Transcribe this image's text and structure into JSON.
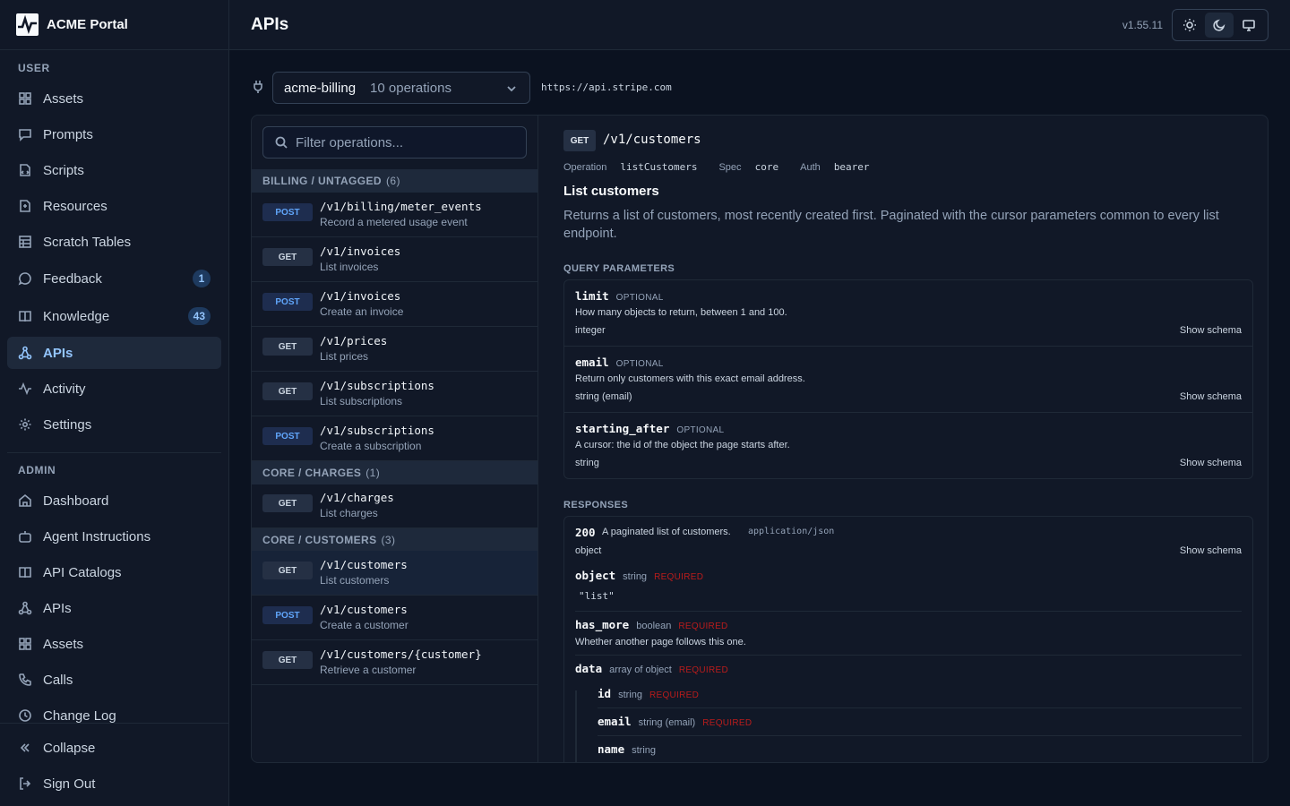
{
  "app": {
    "name": "ACME Portal",
    "version": "v1.55.11"
  },
  "sidebar": {
    "user_label": "USER",
    "admin_label": "ADMIN",
    "user_items": [
      {
        "label": "Assets",
        "icon": "grid-icon"
      },
      {
        "label": "Prompts",
        "icon": "message-icon"
      },
      {
        "label": "Scripts",
        "icon": "code-icon"
      },
      {
        "label": "Resources",
        "icon": "file-icon"
      },
      {
        "label": "Scratch Tables",
        "icon": "table-icon"
      },
      {
        "label": "Feedback",
        "icon": "chat-icon",
        "badge": "1"
      },
      {
        "label": "Knowledge",
        "icon": "book-icon",
        "badge": "43"
      },
      {
        "label": "APIs",
        "icon": "network-icon",
        "active": true
      },
      {
        "label": "Activity",
        "icon": "activity-icon"
      },
      {
        "label": "Settings",
        "icon": "gear-icon"
      }
    ],
    "admin_items": [
      {
        "label": "Dashboard",
        "icon": "home-icon"
      },
      {
        "label": "Agent Instructions",
        "icon": "bot-icon"
      },
      {
        "label": "API Catalogs",
        "icon": "book-icon"
      },
      {
        "label": "APIs",
        "icon": "network-icon"
      },
      {
        "label": "Assets",
        "icon": "grid-icon"
      },
      {
        "label": "Calls",
        "icon": "phone-icon"
      },
      {
        "label": "Change Log",
        "icon": "clock-icon"
      }
    ],
    "footer": {
      "collapse": "Collapse",
      "sign_out": "Sign Out"
    }
  },
  "header": {
    "title": "APIs"
  },
  "toolbar": {
    "api_name": "acme-billing",
    "api_ops": "10 operations",
    "base_url": "https://api.stripe.com"
  },
  "ops": {
    "filter_placeholder": "Filter operations...",
    "groups": [
      {
        "name": "BILLING / UNTAGGED",
        "count": "(6)",
        "items": [
          {
            "method": "POST",
            "path": "/v1/billing/meter_events",
            "summary": "Record a metered usage event"
          },
          {
            "method": "GET",
            "path": "/v1/invoices",
            "summary": "List invoices"
          },
          {
            "method": "POST",
            "path": "/v1/invoices",
            "summary": "Create an invoice"
          },
          {
            "method": "GET",
            "path": "/v1/prices",
            "summary": "List prices"
          },
          {
            "method": "GET",
            "path": "/v1/subscriptions",
            "summary": "List subscriptions"
          },
          {
            "method": "POST",
            "path": "/v1/subscriptions",
            "summary": "Create a subscription"
          }
        ]
      },
      {
        "name": "CORE / CHARGES",
        "count": "(1)",
        "items": [
          {
            "method": "GET",
            "path": "/v1/charges",
            "summary": "List charges"
          }
        ]
      },
      {
        "name": "CORE / CUSTOMERS",
        "count": "(3)",
        "items": [
          {
            "method": "GET",
            "path": "/v1/customers",
            "summary": "List customers",
            "selected": true
          },
          {
            "method": "POST",
            "path": "/v1/customers",
            "summary": "Create a customer"
          },
          {
            "method": "GET",
            "path": "/v1/customers/{customer}",
            "summary": "Retrieve a customer"
          }
        ]
      }
    ]
  },
  "detail": {
    "method": "GET",
    "path": "/v1/customers",
    "meta": {
      "op_label": "Operation",
      "op_value": "listCustomers",
      "spec_label": "Spec",
      "spec_value": "core",
      "auth_label": "Auth",
      "auth_value": "bearer"
    },
    "title": "List customers",
    "description": "Returns a list of customers, most recently created first. Paginated with the cursor parameters common to every list endpoint.",
    "query_label": "QUERY PARAMETERS",
    "params": [
      {
        "name": "limit",
        "flag": "OPTIONAL",
        "desc": "How many objects to return, between 1 and 100.",
        "type": "integer",
        "action": "Show schema"
      },
      {
        "name": "email",
        "flag": "OPTIONAL",
        "desc": "Return only customers with this exact email address.",
        "type": "string (email)",
        "action": "Show schema"
      },
      {
        "name": "starting_after",
        "flag": "OPTIONAL",
        "desc": "A cursor: the id of the object the page starts after.",
        "type": "string",
        "action": "Show schema"
      }
    ],
    "responses_label": "RESPONSES",
    "response": {
      "code": "200",
      "desc": "A paginated list of customers.",
      "content_type": "application/json",
      "kind": "object",
      "action": "Show schema",
      "fields": [
        {
          "name": "object",
          "type": "string",
          "req": "REQUIRED",
          "value": "\"list\""
        },
        {
          "name": "has_more",
          "type": "boolean",
          "req": "REQUIRED",
          "desc": "Whether another page follows this one."
        },
        {
          "name": "data",
          "type": "array of object",
          "req": "REQUIRED"
        }
      ],
      "nested": [
        {
          "name": "id",
          "type": "string",
          "req": "REQUIRED"
        },
        {
          "name": "email",
          "type": "string (email)",
          "req": "REQUIRED"
        },
        {
          "name": "name",
          "type": "string",
          "req": ""
        }
      ]
    }
  },
  "colors": {
    "accent": "#93c5fd",
    "post": "#60a5fa",
    "required": "#b91c1c",
    "background": "#0b1220"
  }
}
